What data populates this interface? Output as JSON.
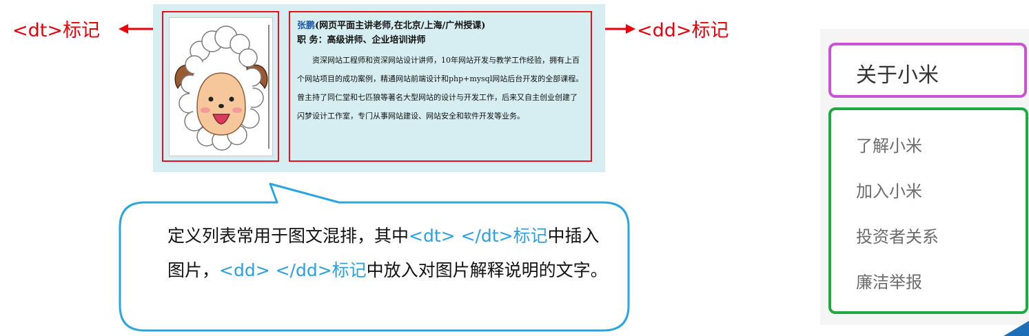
{
  "annotations": {
    "dt_label": "<dt>标记",
    "dd_label": "<dd>标记"
  },
  "demo": {
    "name": "张鹏",
    "name_suffix": "(网页平面主讲老师,在北京/上海/广州授课)",
    "role": "职  务：高级讲师、企业培训讲师",
    "bio": "资深网站工程师和资深网站设计讲师，10年网站开发与教学工作经验，拥有上百个网站项目的成功案例，精通网站前端设计和php+mysql网站后台开发的全部课程。曾主持了同仁堂和七匹狼等著名大型网站的设计与开发工作，后来又自主创业创建了闪梦设计工作室，专门从事网站建设、网站安全和软件开发等业务。"
  },
  "callout": {
    "part1": "定义列表常用于图文混排，其中",
    "code1": "<dt> </dt>标记",
    "part2": "中插入图片，",
    "code2": "<dd> </dd>标记",
    "part3": "中放入对图片解释说明的文字。"
  },
  "nav": {
    "heading": "关于小米",
    "items": [
      "了解小米",
      "加入小米",
      "投资者关系",
      "廉洁举报"
    ]
  },
  "colors": {
    "annotation_red": "#e8000b",
    "highlight_blue": "#2aa0e4",
    "callout_border": "#2aa6de",
    "heading_box": "#c954d3",
    "list_box": "#1faa3f",
    "panel_bg": "#d6eef1"
  }
}
